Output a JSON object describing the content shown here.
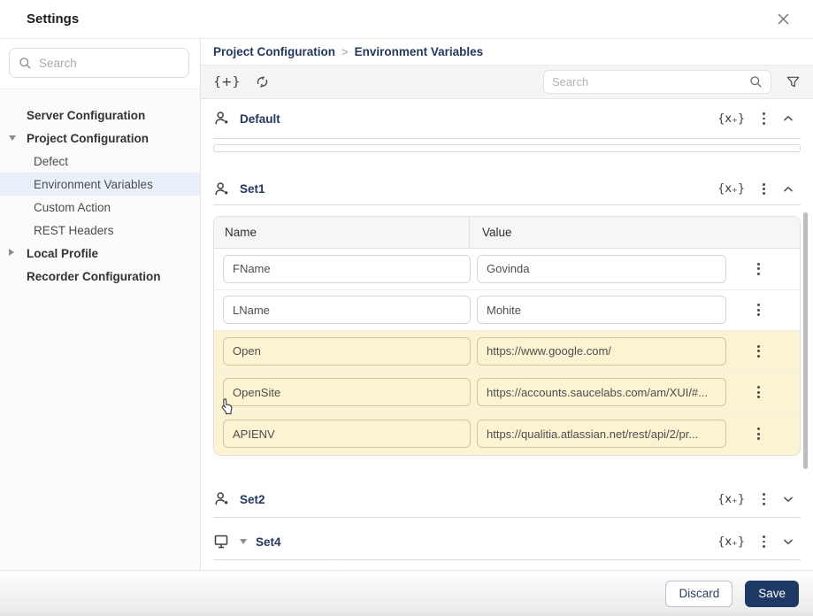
{
  "dialog": {
    "title": "Settings"
  },
  "sidebar": {
    "search": {
      "placeholder": "Search"
    },
    "items": [
      {
        "label": "Server Configuration",
        "level": 0,
        "arrow": "none",
        "selected": false
      },
      {
        "label": "Project Configuration",
        "level": 0,
        "arrow": "down",
        "selected": false
      },
      {
        "label": "Defect",
        "level": 1,
        "arrow": "none",
        "selected": false
      },
      {
        "label": "Environment Variables",
        "level": 1,
        "arrow": "none",
        "selected": true
      },
      {
        "label": "Custom Action",
        "level": 1,
        "arrow": "none",
        "selected": false
      },
      {
        "label": "REST Headers",
        "level": 1,
        "arrow": "none",
        "selected": false
      },
      {
        "label": "Local Profile",
        "level": 0,
        "arrow": "right",
        "selected": false
      },
      {
        "label": "Recorder Configuration",
        "level": 0,
        "arrow": "none",
        "selected": false
      }
    ]
  },
  "breadcrumb": {
    "parent": "Project Configuration",
    "separator": ">",
    "current": "Environment Variables"
  },
  "toolbar": {
    "add_set_icon": "{+}",
    "search": {
      "placeholder": "Search"
    }
  },
  "icons": {
    "brace_x_plus": "{x₊}"
  },
  "sections": {
    "default": {
      "title": "Default",
      "expanded": true
    },
    "set1": {
      "title": "Set1",
      "expanded": true
    },
    "set2": {
      "title": "Set2",
      "expanded": false
    },
    "set4": {
      "title": "Set4",
      "expanded": false
    }
  },
  "variables_table": {
    "columns": {
      "name": "Name",
      "value": "Value"
    },
    "rows": [
      {
        "name": "FName",
        "value": "Govinda",
        "highlighted": false
      },
      {
        "name": "LName",
        "value": "Mohite",
        "highlighted": false
      },
      {
        "name": "Open",
        "value": "https://www.google.com/",
        "highlighted": true
      },
      {
        "name": "OpenSite",
        "value": "https://accounts.saucelabs.com/am/XUI/#...",
        "highlighted": true
      },
      {
        "name": "APIENV",
        "value": "https://qualitia.atlassian.net/rest/api/2/pr...",
        "highlighted": true
      }
    ]
  },
  "footer": {
    "discard_label": "Discard",
    "save_label": "Save"
  },
  "colors": {
    "accent_navy": "#24385e",
    "save_bg": "#1e3a64",
    "highlight_row": "#fbf3d2",
    "selected_item_bg": "#e9f0fa"
  }
}
